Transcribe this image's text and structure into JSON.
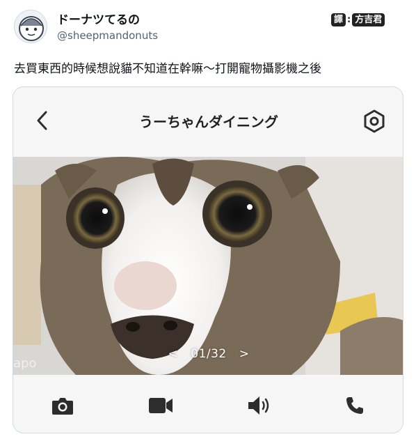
{
  "tweet": {
    "display_name": "ドーナツてるの",
    "handle": "@sheepmandonuts",
    "text": "去買東西的時候想說貓不知道在幹嘛～打開寵物攝影機之後"
  },
  "credit": {
    "prefix": "譯",
    "separator": ":",
    "name": "方吉君"
  },
  "app": {
    "title": "うーちゃんダイニング",
    "pager": {
      "prev": "<",
      "counter": "01/32",
      "next": ">"
    },
    "watermark": "apo"
  },
  "icons": {
    "back": "chevron-left-icon",
    "settings": "hexagon-gear-icon",
    "camera": "camera-icon",
    "video": "video-camera-icon",
    "speaker": "speaker-icon",
    "phone": "phone-icon"
  },
  "colors": {
    "icon": "#2d2d2d",
    "handle": "#536471",
    "card_border": "#cfd9de",
    "app_bg": "#f7f6f7"
  }
}
